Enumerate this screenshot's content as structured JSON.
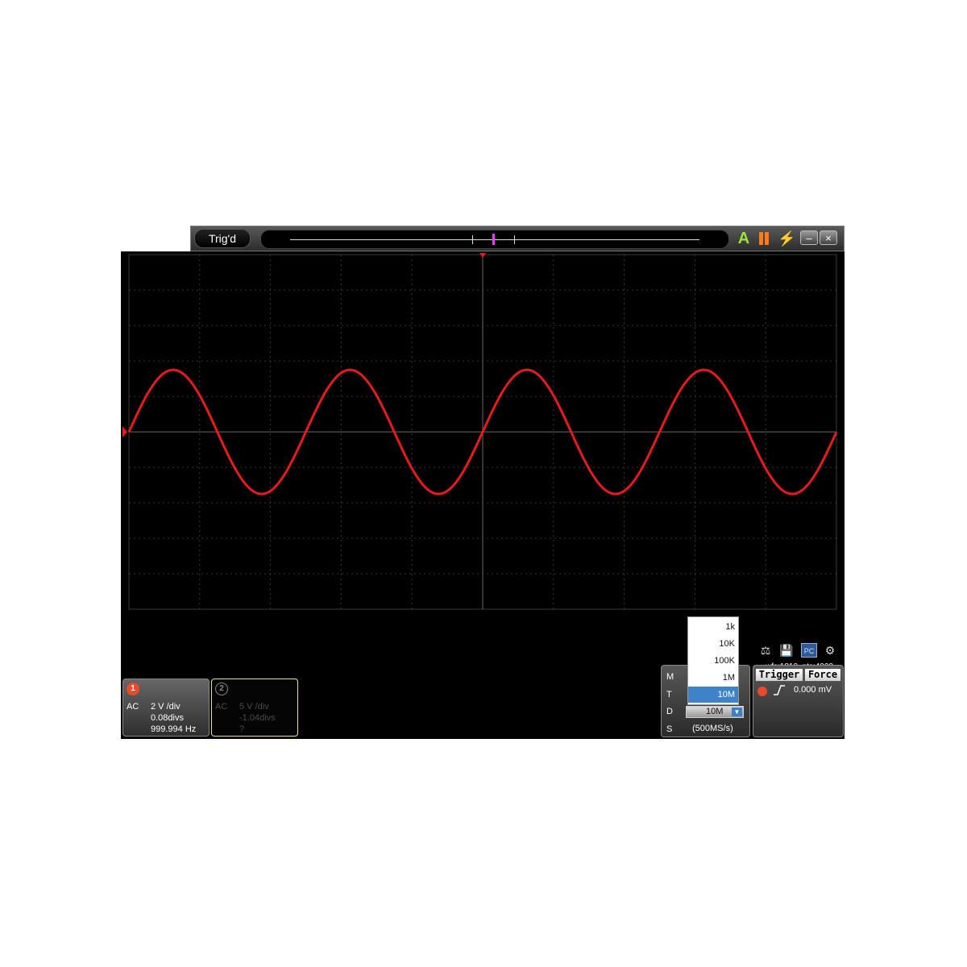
{
  "toolbar": {
    "trigger_status": "Trig'd",
    "auto_glyph": "A",
    "single_glyph": "⚡",
    "minimize_glyph": "–",
    "close_glyph": "×"
  },
  "colors": {
    "ch1": "#e61b1b",
    "grid": "#3a3a3a",
    "grid_axis": "#6a6a6a",
    "screen_bg": "#000000",
    "accent": "#3e82c8"
  },
  "waveform": {
    "cycles_on_screen": 4,
    "amplitude_divs": 1.75,
    "h_divs": 10,
    "v_divs": 10
  },
  "ch1": {
    "badge": "1",
    "coupling": "AC",
    "volts_per_div": "2 V /div",
    "offset": "0.08divs",
    "frequency": "999.994 Hz"
  },
  "ch2": {
    "badge": "2",
    "coupling": "AC",
    "volts_per_div": "5 V /div",
    "offset": "-1.04divs",
    "frequency": "?"
  },
  "acquisition": {
    "info": "wfs:1810, pts:4000"
  },
  "mtds": {
    "m_label": "M",
    "t_label": "T",
    "d_label": "D",
    "s_label": "S",
    "depth_value": "10M",
    "depth_arrow": "▼",
    "sample_rate": "(500MS/s)"
  },
  "depth_menu": {
    "options": [
      "1k",
      "10K",
      "100K",
      "1M",
      "10M"
    ],
    "selected": "10M"
  },
  "trigger": {
    "trigger_label": "Trigger",
    "force_label": "Force",
    "level": "0.000 mV"
  },
  "icons": [
    "probe-icon",
    "save-icon",
    "pc-icon",
    "settings-icon"
  ]
}
